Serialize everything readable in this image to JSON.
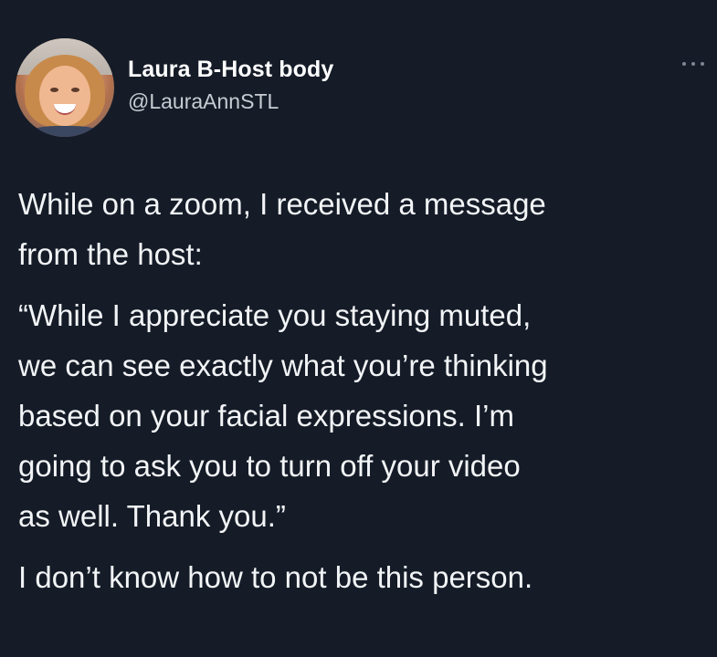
{
  "author": {
    "display_name": "Laura B-Host body",
    "handle": "@LauraAnnSTL"
  },
  "icons": {
    "more": "more-horizontal-icon",
    "avatar": "profile-photo"
  },
  "colors": {
    "background": "#151c28",
    "text": "#f2f4f6",
    "secondary_text": "#c8ccd2"
  },
  "tweet": {
    "paragraphs": [
      "While on a zoom, I received a message\nfrom the host:",
      "“While I appreciate you staying muted,\nwe can see exactly what you’re thinking\nbased on your facial expressions. I’m\ngoing to ask you to turn off your video\nas well. Thank you.”",
      "I don’t know how to not be this person."
    ]
  }
}
